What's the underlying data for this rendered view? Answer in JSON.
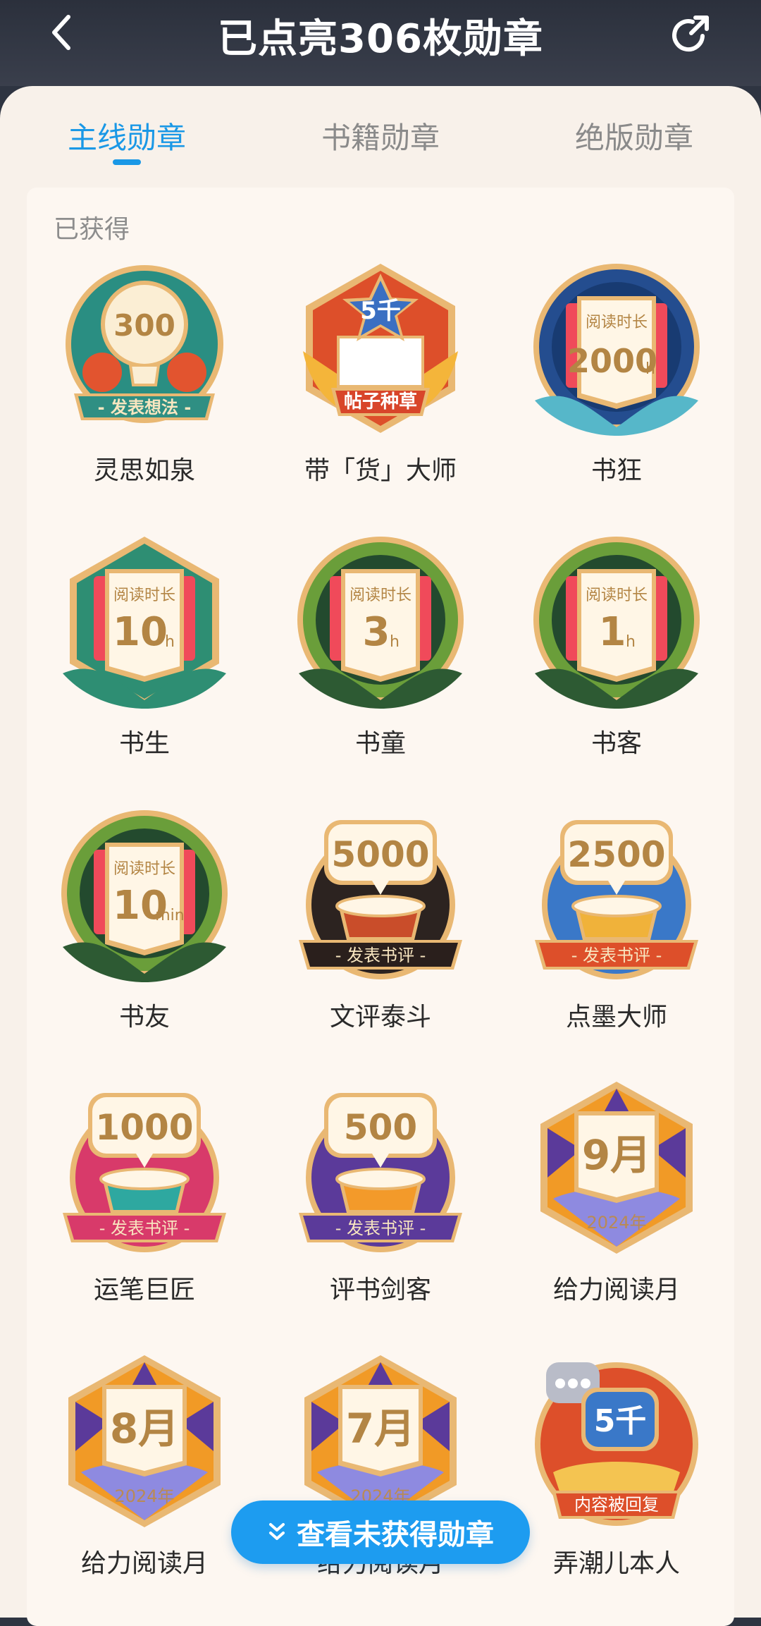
{
  "header": {
    "title": "已点亮306枚勋章"
  },
  "tabs": [
    {
      "label": "主线勋章",
      "active": true
    },
    {
      "label": "书籍勋章",
      "active": false
    },
    {
      "label": "绝版勋章",
      "active": false
    }
  ],
  "section": {
    "label": "已获得"
  },
  "badges": [
    {
      "name": "灵思如泉",
      "top_text": "300",
      "ribbon": "- 发表想法 -"
    },
    {
      "name": "带「货」大师",
      "top_text": "5千",
      "ribbon": "帖子种草"
    },
    {
      "name": "书狂",
      "caption": "阅读时长",
      "value": "2000",
      "unit": "h"
    },
    {
      "name": "书生",
      "caption": "阅读时长",
      "value": "10",
      "unit": "h"
    },
    {
      "name": "书童",
      "caption": "阅读时长",
      "value": "3",
      "unit": "h"
    },
    {
      "name": "书客",
      "caption": "阅读时长",
      "value": "1",
      "unit": "h"
    },
    {
      "name": "书友",
      "caption": "阅读时长",
      "value": "10",
      "unit": "min"
    },
    {
      "name": "文评泰斗",
      "top_text": "5000",
      "ribbon": "- 发表书评 -"
    },
    {
      "name": "点墨大师",
      "top_text": "2500",
      "ribbon": "- 发表书评 -"
    },
    {
      "name": "运笔巨匠",
      "top_text": "1000",
      "ribbon": "- 发表书评 -"
    },
    {
      "name": "评书剑客",
      "top_text": "500",
      "ribbon": "- 发表书评 -"
    },
    {
      "name": "给力阅读月",
      "top_text": "9月",
      "year": "2024年"
    },
    {
      "name": "给力阅读月",
      "top_text": "8月",
      "year": "2024年"
    },
    {
      "name": "给力阅读月",
      "top_text": "7月",
      "year": "2024年"
    },
    {
      "name": "弄潮儿本人",
      "top_text": "5千",
      "ribbon": "内容被回复"
    }
  ],
  "footer_button": {
    "label": "查看未获得勋章",
    "icon": "double-chevron-down-icon"
  },
  "icons": {
    "back": "back-chevron-icon",
    "share": "share-icon"
  },
  "colors": {
    "accent": "#1a98e6",
    "header_bg": "#2e3441",
    "sheet_bg": "#f8f1ea"
  }
}
